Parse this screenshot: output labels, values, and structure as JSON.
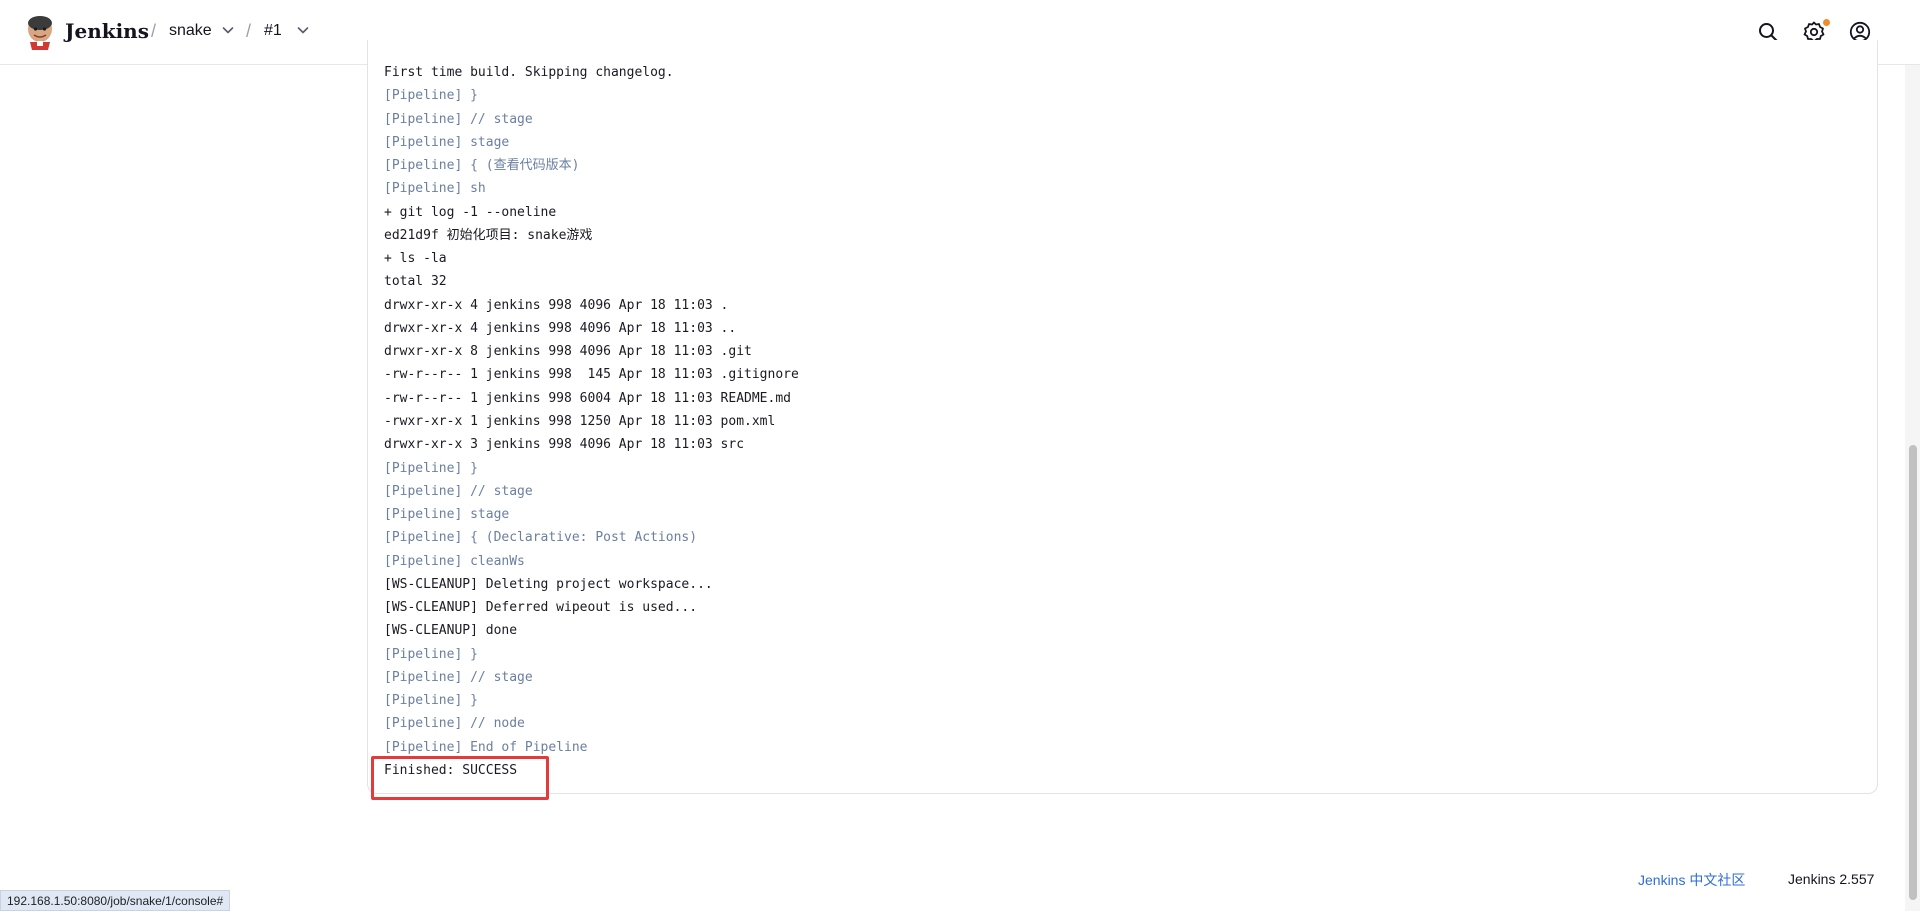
{
  "header": {
    "brand": "Jenkins",
    "breadcrumbs": [
      {
        "label": "snake"
      },
      {
        "label": "#1"
      }
    ]
  },
  "console": {
    "lines": [
      {
        "text": "First time build. Skipping changelog.",
        "kind": "output"
      },
      {
        "text": "[Pipeline] }",
        "kind": "pipeline"
      },
      {
        "text": "[Pipeline] // stage",
        "kind": "pipeline"
      },
      {
        "text": "[Pipeline] stage",
        "kind": "pipeline"
      },
      {
        "text": "[Pipeline] { (查看代码版本)",
        "kind": "pipeline"
      },
      {
        "text": "[Pipeline] sh",
        "kind": "pipeline"
      },
      {
        "text": "+ git log -1 --oneline",
        "kind": "output"
      },
      {
        "text": "ed21d9f 初始化项目: snake游戏",
        "kind": "output"
      },
      {
        "text": "+ ls -la",
        "kind": "output"
      },
      {
        "text": "total 32",
        "kind": "output"
      },
      {
        "text": "drwxr-xr-x 4 jenkins 998 4096 Apr 18 11:03 .",
        "kind": "output"
      },
      {
        "text": "drwxr-xr-x 4 jenkins 998 4096 Apr 18 11:03 ..",
        "kind": "output"
      },
      {
        "text": "drwxr-xr-x 8 jenkins 998 4096 Apr 18 11:03 .git",
        "kind": "output"
      },
      {
        "text": "-rw-r--r-- 1 jenkins 998  145 Apr 18 11:03 .gitignore",
        "kind": "output"
      },
      {
        "text": "-rw-r--r-- 1 jenkins 998 6004 Apr 18 11:03 README.md",
        "kind": "output"
      },
      {
        "text": "-rwxr-xr-x 1 jenkins 998 1250 Apr 18 11:03 pom.xml",
        "kind": "output"
      },
      {
        "text": "drwxr-xr-x 3 jenkins 998 4096 Apr 18 11:03 src",
        "kind": "output"
      },
      {
        "text": "[Pipeline] }",
        "kind": "pipeline"
      },
      {
        "text": "[Pipeline] // stage",
        "kind": "pipeline"
      },
      {
        "text": "[Pipeline] stage",
        "kind": "pipeline"
      },
      {
        "text": "[Pipeline] { (Declarative: Post Actions)",
        "kind": "pipeline"
      },
      {
        "text": "[Pipeline] cleanWs",
        "kind": "pipeline"
      },
      {
        "text": "[WS-CLEANUP] Deleting project workspace...",
        "kind": "output"
      },
      {
        "text": "[WS-CLEANUP] Deferred wipeout is used...",
        "kind": "output"
      },
      {
        "text": "[WS-CLEANUP] done",
        "kind": "output"
      },
      {
        "text": "[Pipeline] }",
        "kind": "pipeline"
      },
      {
        "text": "[Pipeline] // stage",
        "kind": "pipeline"
      },
      {
        "text": "[Pipeline] }",
        "kind": "pipeline"
      },
      {
        "text": "[Pipeline] // node",
        "kind": "pipeline"
      },
      {
        "text": "[Pipeline] End of Pipeline",
        "kind": "pipeline"
      },
      {
        "text": "Finished: SUCCESS",
        "kind": "output"
      }
    ]
  },
  "footer": {
    "community_link": "Jenkins 中文社区",
    "version": "Jenkins 2.557"
  },
  "status_bar": {
    "url": "192.168.1.50:8080/job/snake/1/console#"
  },
  "colors": {
    "pipeline_text": "#6b7fa1",
    "highlight": "#e33b3b",
    "notification": "#f28c28",
    "link": "#2e6ed8"
  },
  "icons": {
    "logo": "jenkins-logo",
    "search": "search-icon",
    "settings": "gear-icon",
    "account": "user-icon",
    "breadcrumb_dropdown": "chevron-down-icon"
  }
}
